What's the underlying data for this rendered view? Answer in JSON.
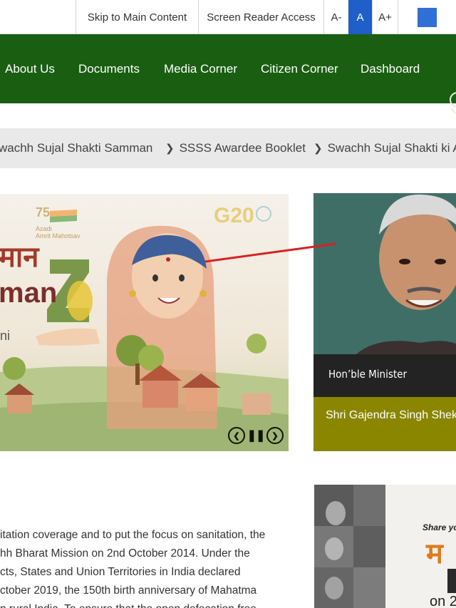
{
  "topbar": {
    "skip": "Skip to Main Content",
    "reader": "Screen Reader Access",
    "font_decrease": "A-",
    "font_normal": "A",
    "font_increase": "A+",
    "contrast_color": "#2f6fd6"
  },
  "nav": {
    "items": [
      "About Us",
      "Documents",
      "Media Corner",
      "Citizen Corner",
      "Dashboard"
    ],
    "bg_color": "#1a5e12"
  },
  "ticker": {
    "items": [
      "wachh Sujal Shakti Samman",
      "SSSS Awardee Booklet",
      "Swachh Sujal Shakti ki Ab"
    ]
  },
  "slider": {
    "partial_text_1": "मान",
    "partial_text_2": "man",
    "partial_text_3": "ni",
    "g20": "G20",
    "azadi": "Azadi",
    "amrit": "Amrit Mahotsav",
    "seventy_five": "75"
  },
  "minister": {
    "label": "Hon’ble Minister",
    "name": "Shri Gajendra Singh Shek"
  },
  "body": {
    "lines": [
      "itation coverage and to put the focus on sanitation, the",
      "hh Bharat Mission on 2nd October 2014. Under the",
      "cts, States and Union Territories in India declared",
      "ctober 2019, the 150th birth anniversary of Mahatma",
      "n rural India. To ensure that the open defecation free"
    ]
  },
  "share": {
    "text": "Share yo",
    "big": "म",
    "small": "on 2"
  }
}
